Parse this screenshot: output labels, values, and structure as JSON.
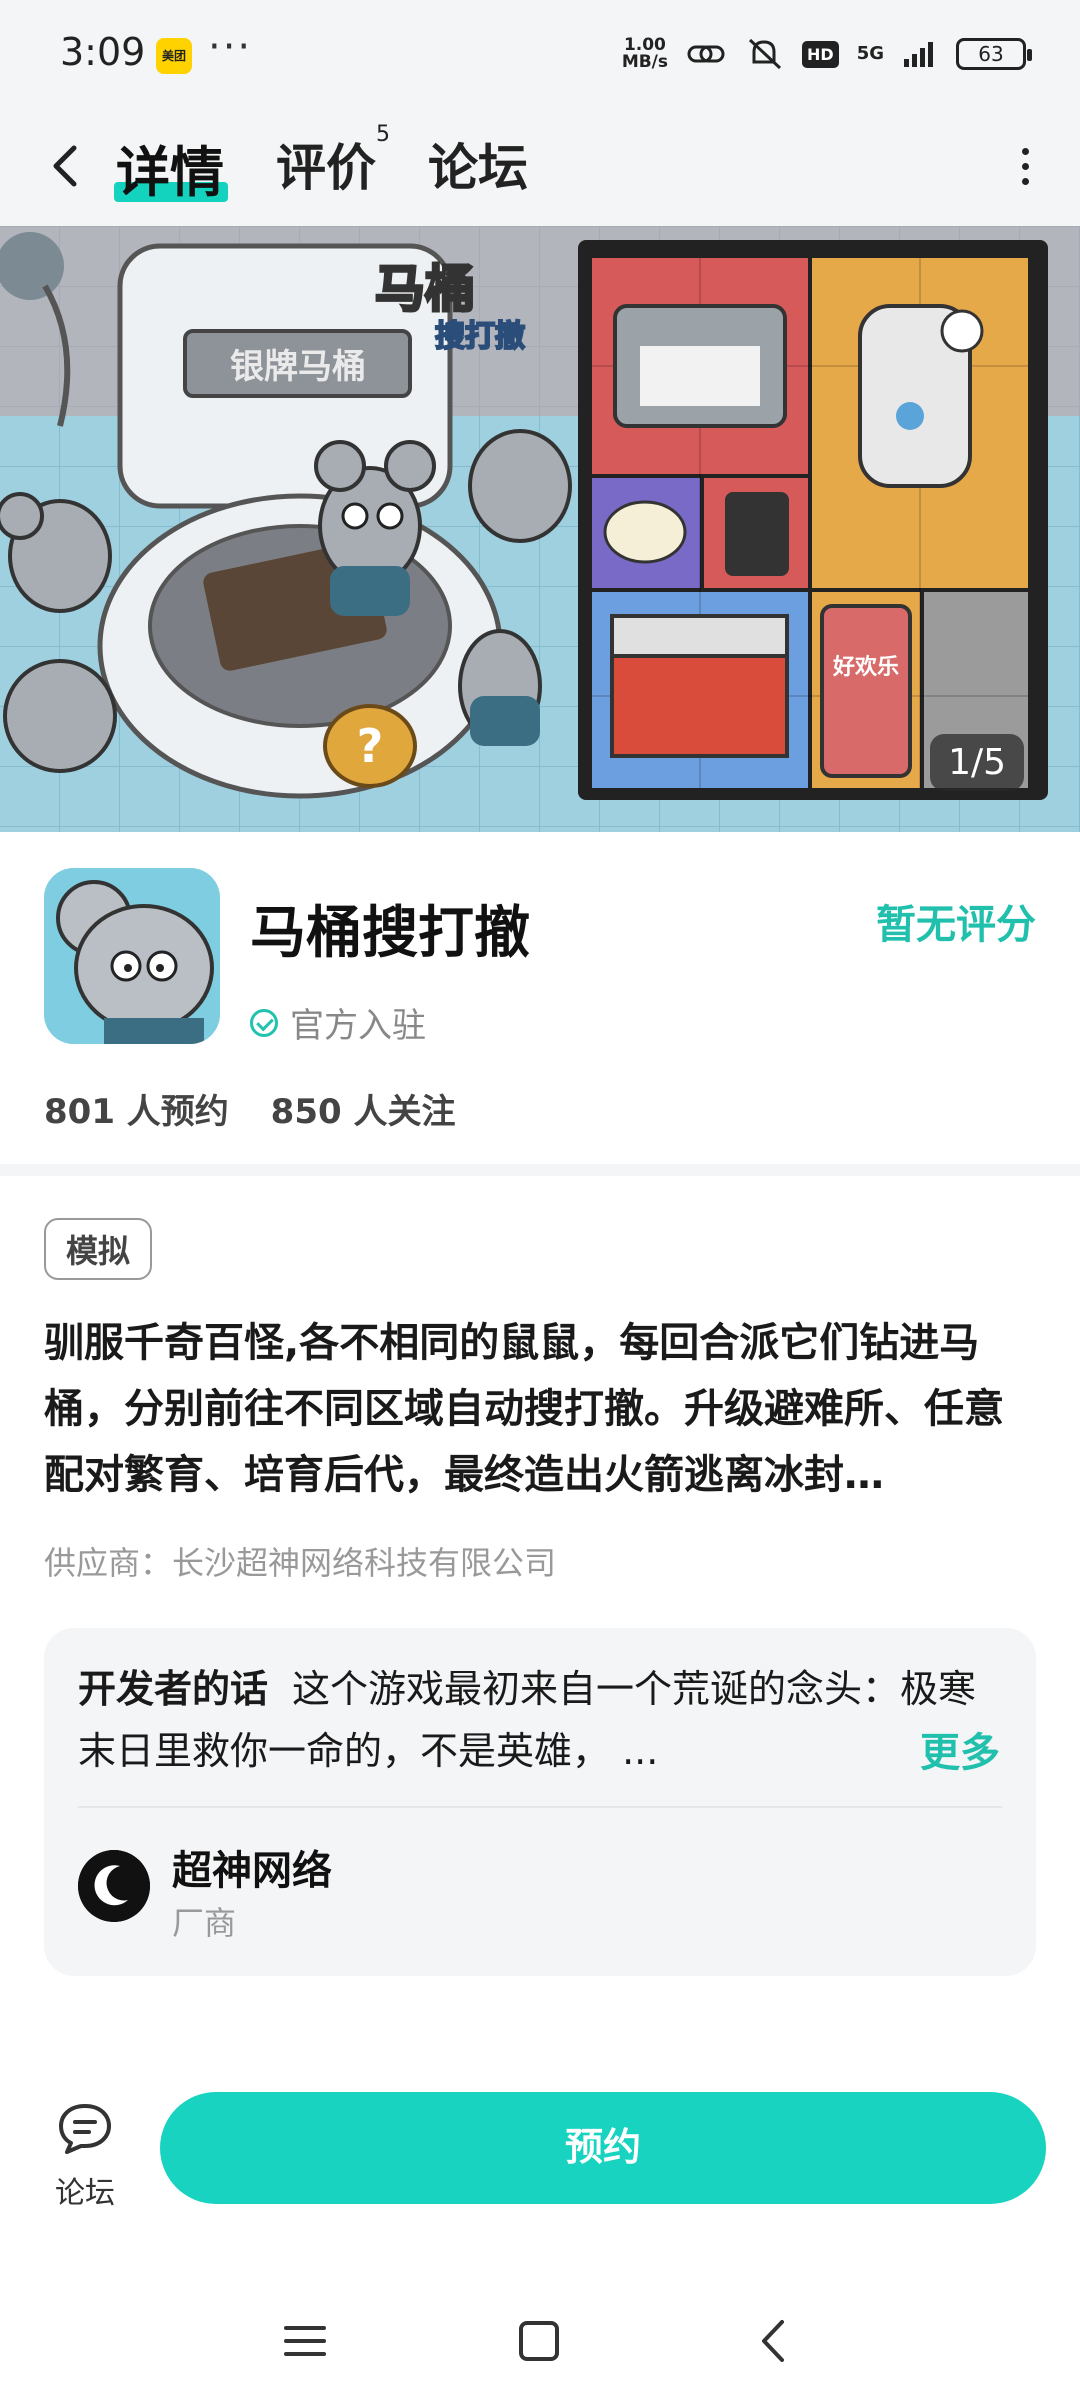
{
  "status_bar": {
    "time": "3:09",
    "app_badge": "美团",
    "dots": "···",
    "speed_value": "1.00",
    "speed_unit": "MB/s",
    "hd": "HD",
    "network": "5G",
    "battery": "63"
  },
  "nav": {
    "tabs": [
      {
        "label": "详情"
      },
      {
        "label": "评价",
        "badge": "5"
      },
      {
        "label": "论坛"
      }
    ]
  },
  "banner": {
    "sign_text": "银牌马桶",
    "logo_line1": "马桶",
    "logo_line2": "搜打撤",
    "snack_label": "好欢乐",
    "indicator": "1/5"
  },
  "app": {
    "name": "马桶搜打撤",
    "rating": "暂无评分",
    "official": "官方入驻",
    "reservations": "801 人预约",
    "followers": "850 人关注"
  },
  "tag": "模拟",
  "description": "驯服千奇百怪,各不相同的鼠鼠，每回合派它们钻进马桶，分别前往不同区域自动搜打撤。升级避难所、任意配对繁育、培育后代，最终造出火箭逃离冰封…",
  "supplier": "供应商：长沙超神网络科技有限公司",
  "developer": {
    "title": "开发者的话",
    "text": "这个游戏最初来自一个荒诞的念头：极寒末日里救你一命的，不是英雄，  ...",
    "more": "更多",
    "name": "超神网络",
    "role": "厂商"
  },
  "actions": {
    "forum": "论坛",
    "reserve": "预约"
  },
  "colors": {
    "accent": "#18d3c0",
    "accent_text": "#20c0ad"
  }
}
